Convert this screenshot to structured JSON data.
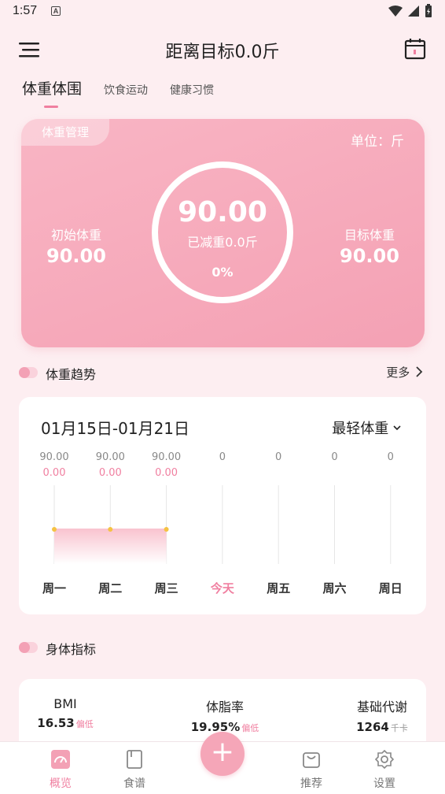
{
  "status_bar": {
    "time": "1:57",
    "badge": "A"
  },
  "header": {
    "title": "距离目标0.0斤"
  },
  "tabs": [
    {
      "label": "体重体围",
      "active": true
    },
    {
      "label": "饮食运动",
      "active": false
    },
    {
      "label": "健康习惯",
      "active": false
    }
  ],
  "hero": {
    "tag": "体重管理",
    "unit": "单位：斤",
    "initial_label": "初始体重",
    "initial_value": "90.00",
    "target_label": "目标体重",
    "target_value": "90.00",
    "current_value": "90.00",
    "lost_text": "已减重0.0斤",
    "percent": "0%"
  },
  "trend_section": {
    "title": "体重趋势",
    "more": "更多"
  },
  "trend_card": {
    "date_range": "01月15日-01月21日",
    "select_label": "最轻体重"
  },
  "chart_data": {
    "type": "area",
    "categories": [
      "周一",
      "周二",
      "周三",
      "今天",
      "周五",
      "周六",
      "周日"
    ],
    "top_labels": [
      "90.00",
      "90.00",
      "90.00",
      "0",
      "0",
      "0",
      "0"
    ],
    "change_labels": [
      "0.00",
      "0.00",
      "0.00",
      "",
      "",
      "",
      ""
    ],
    "values": [
      90.0,
      90.0,
      90.0,
      null,
      null,
      null,
      null
    ],
    "highlight_index": 3,
    "colors": {
      "accent": "#f07fa0",
      "point": "#f5c242",
      "fill": "#f9c4d0"
    }
  },
  "body_section": {
    "title": "身体指标"
  },
  "metrics": [
    {
      "label": "BMI",
      "value": "16.53",
      "note": "偏低"
    },
    {
      "label": "体脂率",
      "value": "19.95%",
      "note": "偏低"
    },
    {
      "label": "基础代谢",
      "value": "1264",
      "note": "千卡"
    }
  ],
  "nav": [
    {
      "label": "概览",
      "icon": "gauge-icon",
      "active": true
    },
    {
      "label": "食谱",
      "icon": "book-icon",
      "active": false
    },
    {
      "label": "推荐",
      "icon": "bag-icon",
      "active": false
    },
    {
      "label": "设置",
      "icon": "gear-icon",
      "active": false
    }
  ],
  "fab": {
    "label": "+"
  },
  "colors": {
    "accent": "#f07fa0",
    "card_pink": "#f7aebf",
    "background": "#fdeef1"
  }
}
